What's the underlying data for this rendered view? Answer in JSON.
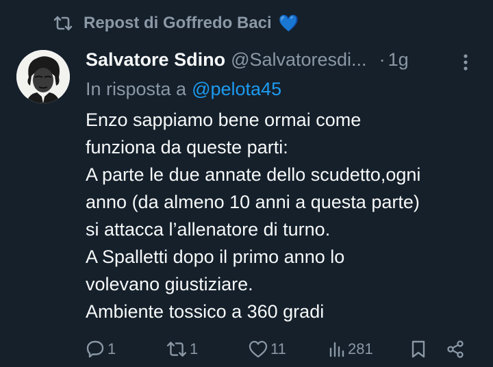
{
  "repost": {
    "label": "Repost di Goffredo Baci",
    "heart": "💙"
  },
  "author": {
    "name": "Salvatore Sdino",
    "handle": "@Salvatoresdi...",
    "dot": "·",
    "time": "1g"
  },
  "reply": {
    "prefix": "In risposta a",
    "mention": "@pelota45"
  },
  "text": [
    "Enzo sappiamo bene ormai come",
    "funziona da queste parti:",
    "A parte le due annate dello scudetto,ogni",
    "anno (da almeno 10 anni a questa parte)",
    "si attacca l’allenatore di turno.",
    "A Spalletti dopo il primo anno lo",
    "volevano giustiziare.",
    "Ambiente tossico a 360 gradi"
  ],
  "actions": {
    "replies": "1",
    "reposts": "1",
    "likes": "11",
    "views": "281"
  },
  "colors": {
    "background": "#15202b",
    "text": "#f7f9f9",
    "muted": "#8b98a5",
    "link": "#1d9bf0"
  },
  "icons": [
    "repost-icon",
    "more-icon",
    "reply-icon",
    "like-icon",
    "views-icon",
    "bookmark-icon",
    "share-icon"
  ]
}
